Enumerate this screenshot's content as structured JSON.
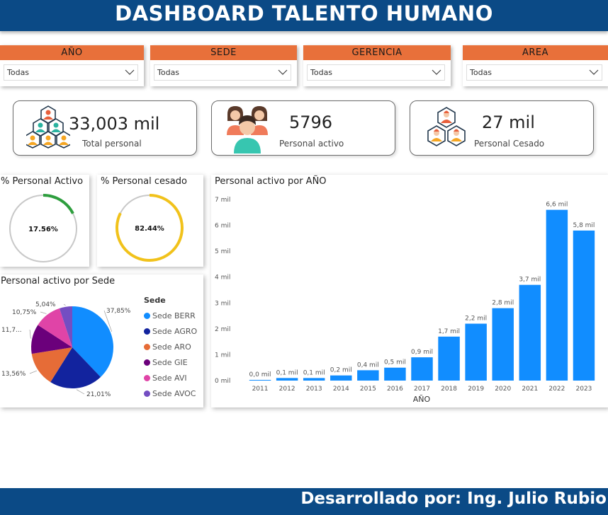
{
  "header": {
    "title": "DASHBOARD TALENTO HUMANO"
  },
  "filters": [
    {
      "label": "AÑO",
      "value": "Todas"
    },
    {
      "label": "SEDE",
      "value": "Todas"
    },
    {
      "label": "GERENCIA",
      "value": "Todas"
    },
    {
      "label": "AREA",
      "value": "Todas"
    }
  ],
  "kpis": {
    "total": {
      "value": "33,003 mil",
      "label": "Total personal",
      "icon": "people-network-icon"
    },
    "active": {
      "value": "5796",
      "label": "Personal activo",
      "icon": "people-group-icon"
    },
    "ceased": {
      "value": "27 mil",
      "label": "Personal Cesado",
      "icon": "people-network-icon"
    }
  },
  "gauges": {
    "active": {
      "title": "% Personal Activo",
      "value_label": "17.56%",
      "fraction": 0.1756,
      "color": "#2e9e3e"
    },
    "ceased": {
      "title": "% Personal cesado",
      "value_label": "82.44%",
      "fraction": 0.8244,
      "color": "#f1c21b"
    }
  },
  "chart_data": [
    {
      "type": "pie",
      "title": "Personal activo por Sede",
      "legend_title": "Sede",
      "legend_position": "right",
      "categories": [
        "Sede BERR",
        "Sede AGRO",
        "Sede ARO",
        "Sede GIE",
        "Sede AVI",
        "Sede AVOC"
      ],
      "values": [
        37.85,
        21.01,
        13.56,
        11.7,
        10.75,
        5.04
      ],
      "labels": [
        "37,85%",
        "21,01%",
        "13,56%",
        "11,7...",
        "10,75%",
        "5,04%"
      ],
      "colors": [
        "#118dff",
        "#12239e",
        "#e66c37",
        "#6b007b",
        "#e044a7",
        "#744ec2"
      ]
    },
    {
      "type": "bar",
      "title": "Personal activo por AÑO",
      "xlabel": "AÑO",
      "ylabel": "",
      "categories": [
        "2011",
        "2012",
        "2013",
        "2014",
        "2015",
        "2016",
        "2017",
        "2018",
        "2019",
        "2020",
        "2021",
        "2022",
        "2023"
      ],
      "values": [
        0.0,
        0.1,
        0.1,
        0.2,
        0.4,
        0.5,
        0.9,
        1.7,
        2.2,
        2.8,
        3.7,
        6.6,
        5.8
      ],
      "data_labels": [
        "0,0 mil",
        "0,1 mil",
        "0,1 mil",
        "0,2 mil",
        "0,4 mil",
        "0,5 mil",
        "0,9 mil",
        "1,7 mil",
        "2,2 mil",
        "2,8 mil",
        "3,7 mil",
        "6,6 mil",
        "5,8 mil"
      ],
      "yticks": [
        "0 mil",
        "1 mil",
        "2 mil",
        "3 mil",
        "4 mil",
        "5 mil",
        "6 mil",
        "7 mil"
      ],
      "ylim": [
        0,
        7
      ],
      "grid": false,
      "color": "#118dff"
    }
  ],
  "footer": {
    "text": "Desarrollado por: Ing. Julio Rubio"
  }
}
